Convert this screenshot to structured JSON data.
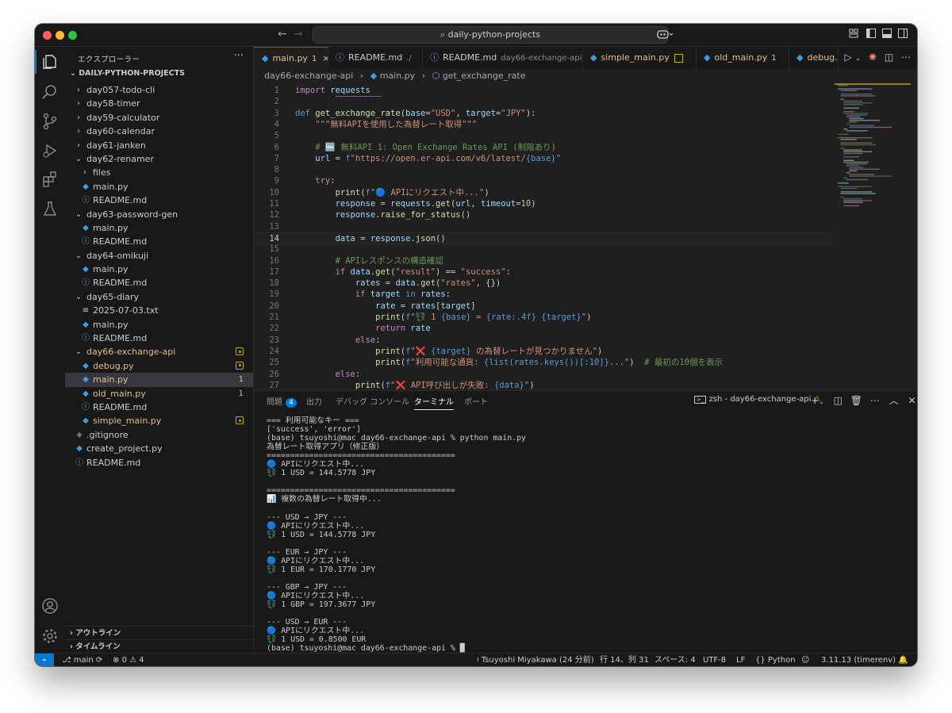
{
  "titlebar": {
    "search": "daily-python-projects"
  },
  "sidebar": {
    "title": "エクスプローラー",
    "more": "···",
    "root": "DAILY-PYTHON-PROJECTS",
    "tree": [
      {
        "name": "day057-todo-cli",
        "type": "folder",
        "open": false,
        "indent": 0
      },
      {
        "name": "day58-timer",
        "type": "folder",
        "open": false,
        "indent": 0
      },
      {
        "name": "day59-calculator",
        "type": "folder",
        "open": false,
        "indent": 0
      },
      {
        "name": "day60-calendar",
        "type": "folder",
        "open": false,
        "indent": 0
      },
      {
        "name": "day61-janken",
        "type": "folder",
        "open": false,
        "indent": 0
      },
      {
        "name": "day62-renamer",
        "type": "folder",
        "open": true,
        "indent": 0
      },
      {
        "name": "files",
        "type": "folder",
        "open": false,
        "indent": 1
      },
      {
        "name": "main.py",
        "type": "py",
        "indent": 1
      },
      {
        "name": "README.md",
        "type": "md",
        "indent": 1
      },
      {
        "name": "day63-password-gen",
        "type": "folder",
        "open": true,
        "indent": 0
      },
      {
        "name": "main.py",
        "type": "py",
        "indent": 1
      },
      {
        "name": "README.md",
        "type": "md",
        "indent": 1
      },
      {
        "name": "day64-omikuji",
        "type": "folder",
        "open": true,
        "indent": 0
      },
      {
        "name": "main.py",
        "type": "py",
        "indent": 1
      },
      {
        "name": "README.md",
        "type": "md",
        "indent": 1
      },
      {
        "name": "day65-diary",
        "type": "folder",
        "open": true,
        "indent": 0
      },
      {
        "name": "2025-07-03.txt",
        "type": "txt",
        "indent": 1
      },
      {
        "name": "main.py",
        "type": "py",
        "indent": 1
      },
      {
        "name": "README.md",
        "type": "md",
        "indent": 1
      },
      {
        "name": "day66-exchange-api",
        "type": "folder",
        "open": true,
        "indent": 0,
        "color": "#e2c08d",
        "badge": "dot"
      },
      {
        "name": "debug.py",
        "type": "py",
        "indent": 1,
        "color": "#e2c08d",
        "badge": "dot"
      },
      {
        "name": "main.py",
        "type": "py",
        "indent": 1,
        "color": "#e2c08d",
        "badge": "1",
        "selected": true
      },
      {
        "name": "old_main.py",
        "type": "py",
        "indent": 1,
        "color": "#e2c08d",
        "badge": "1"
      },
      {
        "name": "README.md",
        "type": "md",
        "indent": 1
      },
      {
        "name": "simple_main.py",
        "type": "py",
        "indent": 1,
        "color": "#e2c08d",
        "badge": "dot"
      },
      {
        "name": ".gitignore",
        "type": "git",
        "indent": 0
      },
      {
        "name": "create_project.py",
        "type": "py",
        "indent": 0
      },
      {
        "name": "README.md",
        "type": "md",
        "indent": 0
      }
    ],
    "outline": "アウトライン",
    "timeline": "タイムライン"
  },
  "tabs": [
    {
      "label": "main.py",
      "suffix": "1",
      "kind": "py",
      "active": true,
      "color": "#e2c08d",
      "close": "×"
    },
    {
      "label": "README.md",
      "suffix": "./",
      "kind": "md",
      "color": "#cccccc"
    },
    {
      "label": "README.md",
      "suffix": "day66-exchange-api",
      "kind": "md",
      "color": "#cccccc"
    },
    {
      "label": "simple_main.py",
      "suffix": "",
      "kind": "py",
      "color": "#e2c08d",
      "dot": true
    },
    {
      "label": "old_main.py",
      "suffix": "1",
      "kind": "py",
      "color": "#e2c08d"
    },
    {
      "label": "debug.",
      "suffix": "",
      "kind": "py",
      "color": "#e2c08d"
    }
  ],
  "breadcrumb": {
    "folder": "day66-exchange-api",
    "file": "main.py",
    "symbol": "get_exchange_rate"
  },
  "editor": {
    "current_line": 14,
    "lines": [
      [
        {
          "t": "import ",
          "c": "kw"
        },
        {
          "t": "requests",
          "c": "va"
        }
      ],
      [],
      [
        {
          "t": "def ",
          "c": "kb"
        },
        {
          "t": "get_exchange_rate",
          "c": "fn"
        },
        {
          "t": "(",
          "c": ""
        },
        {
          "t": "base",
          "c": "va"
        },
        {
          "t": "=",
          "c": ""
        },
        {
          "t": "\"USD\"",
          "c": "st"
        },
        {
          "t": ", ",
          "c": ""
        },
        {
          "t": "target",
          "c": "va"
        },
        {
          "t": "=",
          "c": ""
        },
        {
          "t": "\"JPY\"",
          "c": "st"
        },
        {
          "t": "):",
          "c": ""
        }
      ],
      [
        {
          "t": "    \"\"\"無料APIを使用した為替レート取得\"\"\"",
          "c": "st"
        }
      ],
      [],
      [
        {
          "t": "    # 🆓 無料API 1: Open Exchange Rates API (制限あり)",
          "c": "cm"
        }
      ],
      [
        {
          "t": "    ",
          "c": ""
        },
        {
          "t": "url",
          "c": "va"
        },
        {
          "t": " = ",
          "c": ""
        },
        {
          "t": "f",
          "c": "kb"
        },
        {
          "t": "\"https://open.er-api.com/v6/latest/",
          "c": "st"
        },
        {
          "t": "{base}",
          "c": "bl"
        },
        {
          "t": "\"",
          "c": "st"
        }
      ],
      [],
      [
        {
          "t": "    try",
          "c": "kw"
        },
        {
          "t": ":",
          "c": ""
        }
      ],
      [
        {
          "t": "        ",
          "c": ""
        },
        {
          "t": "print",
          "c": "fn"
        },
        {
          "t": "(",
          "c": ""
        },
        {
          "t": "f",
          "c": "kb"
        },
        {
          "t": "\"🔵 APIにリクエスト中...\"",
          "c": "st"
        },
        {
          "t": ")",
          "c": ""
        }
      ],
      [
        {
          "t": "        ",
          "c": ""
        },
        {
          "t": "response",
          "c": "va"
        },
        {
          "t": " = ",
          "c": ""
        },
        {
          "t": "requests",
          "c": "va"
        },
        {
          "t": ".",
          "c": ""
        },
        {
          "t": "get",
          "c": "fn"
        },
        {
          "t": "(",
          "c": ""
        },
        {
          "t": "url",
          "c": "va"
        },
        {
          "t": ", ",
          "c": ""
        },
        {
          "t": "timeout",
          "c": "va"
        },
        {
          "t": "=",
          "c": ""
        },
        {
          "t": "10",
          "c": "nu"
        },
        {
          "t": ")",
          "c": ""
        }
      ],
      [
        {
          "t": "        ",
          "c": ""
        },
        {
          "t": "response",
          "c": "va"
        },
        {
          "t": ".",
          "c": ""
        },
        {
          "t": "raise_for_status",
          "c": "fn"
        },
        {
          "t": "()",
          "c": ""
        }
      ],
      [],
      [
        {
          "t": "        ",
          "c": ""
        },
        {
          "t": "data",
          "c": "va"
        },
        {
          "t": " = ",
          "c": ""
        },
        {
          "t": "response",
          "c": "va"
        },
        {
          "t": ".",
          "c": ""
        },
        {
          "t": "json",
          "c": "fn"
        },
        {
          "t": "()",
          "c": ""
        }
      ],
      [],
      [
        {
          "t": "        # APIレスポンスの構造確認",
          "c": "cm"
        }
      ],
      [
        {
          "t": "        if ",
          "c": "kw"
        },
        {
          "t": "data",
          "c": "va"
        },
        {
          "t": ".",
          "c": ""
        },
        {
          "t": "get",
          "c": "fn"
        },
        {
          "t": "(",
          "c": ""
        },
        {
          "t": "\"result\"",
          "c": "st"
        },
        {
          "t": ") == ",
          "c": ""
        },
        {
          "t": "\"success\"",
          "c": "st"
        },
        {
          "t": ":",
          "c": ""
        }
      ],
      [
        {
          "t": "            ",
          "c": ""
        },
        {
          "t": "rates",
          "c": "va"
        },
        {
          "t": " = ",
          "c": ""
        },
        {
          "t": "data",
          "c": "va"
        },
        {
          "t": ".",
          "c": ""
        },
        {
          "t": "get",
          "c": "fn"
        },
        {
          "t": "(",
          "c": ""
        },
        {
          "t": "\"rates\"",
          "c": "st"
        },
        {
          "t": ", {})",
          "c": ""
        }
      ],
      [
        {
          "t": "            if ",
          "c": "kw"
        },
        {
          "t": "target",
          "c": "va"
        },
        {
          "t": " in ",
          "c": "kb"
        },
        {
          "t": "rates",
          "c": "va"
        },
        {
          "t": ":",
          "c": ""
        }
      ],
      [
        {
          "t": "                ",
          "c": ""
        },
        {
          "t": "rate",
          "c": "va"
        },
        {
          "t": " = ",
          "c": ""
        },
        {
          "t": "rates",
          "c": "va"
        },
        {
          "t": "[",
          "c": ""
        },
        {
          "t": "target",
          "c": "va"
        },
        {
          "t": "]",
          "c": ""
        }
      ],
      [
        {
          "t": "                ",
          "c": ""
        },
        {
          "t": "print",
          "c": "fn"
        },
        {
          "t": "(",
          "c": ""
        },
        {
          "t": "f",
          "c": "kb"
        },
        {
          "t": "\"💱 1 ",
          "c": "st"
        },
        {
          "t": "{base}",
          "c": "bl"
        },
        {
          "t": " = ",
          "c": "st"
        },
        {
          "t": "{rate:.4f}",
          "c": "bl"
        },
        {
          "t": " ",
          "c": "st"
        },
        {
          "t": "{target}",
          "c": "bl"
        },
        {
          "t": "\"",
          "c": "st"
        },
        {
          "t": ")",
          "c": ""
        }
      ],
      [
        {
          "t": "                return ",
          "c": "kw"
        },
        {
          "t": "rate",
          "c": "va"
        }
      ],
      [
        {
          "t": "            else",
          "c": "kw"
        },
        {
          "t": ":",
          "c": ""
        }
      ],
      [
        {
          "t": "                ",
          "c": ""
        },
        {
          "t": "print",
          "c": "fn"
        },
        {
          "t": "(",
          "c": ""
        },
        {
          "t": "f",
          "c": "kb"
        },
        {
          "t": "\"❌ ",
          "c": "st"
        },
        {
          "t": "{target}",
          "c": "bl"
        },
        {
          "t": " の為替レートが見つかりません\"",
          "c": "st"
        },
        {
          "t": ")",
          "c": ""
        }
      ],
      [
        {
          "t": "                ",
          "c": ""
        },
        {
          "t": "print",
          "c": "fn"
        },
        {
          "t": "(",
          "c": ""
        },
        {
          "t": "f",
          "c": "kb"
        },
        {
          "t": "\"利用可能な通貨: ",
          "c": "st"
        },
        {
          "t": "{list(rates.keys())[:10]}",
          "c": "bl"
        },
        {
          "t": "...\"",
          "c": "st"
        },
        {
          "t": ")  ",
          "c": ""
        },
        {
          "t": "# 最初の10個を表示",
          "c": "cm"
        }
      ],
      [
        {
          "t": "        else",
          "c": "kw"
        },
        {
          "t": ":",
          "c": ""
        }
      ],
      [
        {
          "t": "            ",
          "c": ""
        },
        {
          "t": "print",
          "c": "fn"
        },
        {
          "t": "(",
          "c": ""
        },
        {
          "t": "f",
          "c": "kb"
        },
        {
          "t": "\"❌ API呼び出しが失敗: ",
          "c": "st"
        },
        {
          "t": "{data}",
          "c": "bl"
        },
        {
          "t": "\"",
          "c": "st"
        },
        {
          "t": ")",
          "c": ""
        }
      ],
      []
    ]
  },
  "panel": {
    "tabs": [
      {
        "label": "問題",
        "count": "4"
      },
      {
        "label": "出力"
      },
      {
        "label": "デバッグ コンソール"
      },
      {
        "label": "ターミナル",
        "active": true
      },
      {
        "label": "ポート"
      }
    ],
    "terminal_name": "zsh - day66-exchange-api",
    "terminal_lines": [
      "=== 利用可能なキー ===",
      "['success', 'error']",
      "(base) tsuyoshi@mac day66-exchange-api % python main.py",
      "為替レート取得アプリ（修正版）",
      "========================================",
      "🔵 APIにリクエスト中...",
      "💱 1 USD = 144.5778 JPY",
      "",
      "========================================",
      "📊 複数の為替レート取得中...",
      "",
      "--- USD → JPY ---",
      "🔵 APIにリクエスト中...",
      "💱 1 USD = 144.5778 JPY",
      "",
      "--- EUR → JPY ---",
      "🔵 APIにリクエスト中...",
      "💱 1 EUR = 170.1770 JPY",
      "",
      "--- GBP → JPY ---",
      "🔵 APIにリクエスト中...",
      "💱 1 GBP = 197.3677 JPY",
      "",
      "--- USD → EUR ---",
      "🔵 APIにリクエスト中...",
      "💱 1 USD = 0.8500 EUR",
      "(base) tsuyoshi@mac day66-exchange-api % █"
    ]
  },
  "statusbar": {
    "branch": "main",
    "errors": "0",
    "warnings": "4",
    "author": "Tsuyoshi Miyakawa (24 分前)",
    "position": "行 14、列 31",
    "spaces": "スペース: 4",
    "encoding": "UTF-8",
    "eol": "LF",
    "language": "Python",
    "interpreter": "3.11.13 (timerenv)"
  }
}
